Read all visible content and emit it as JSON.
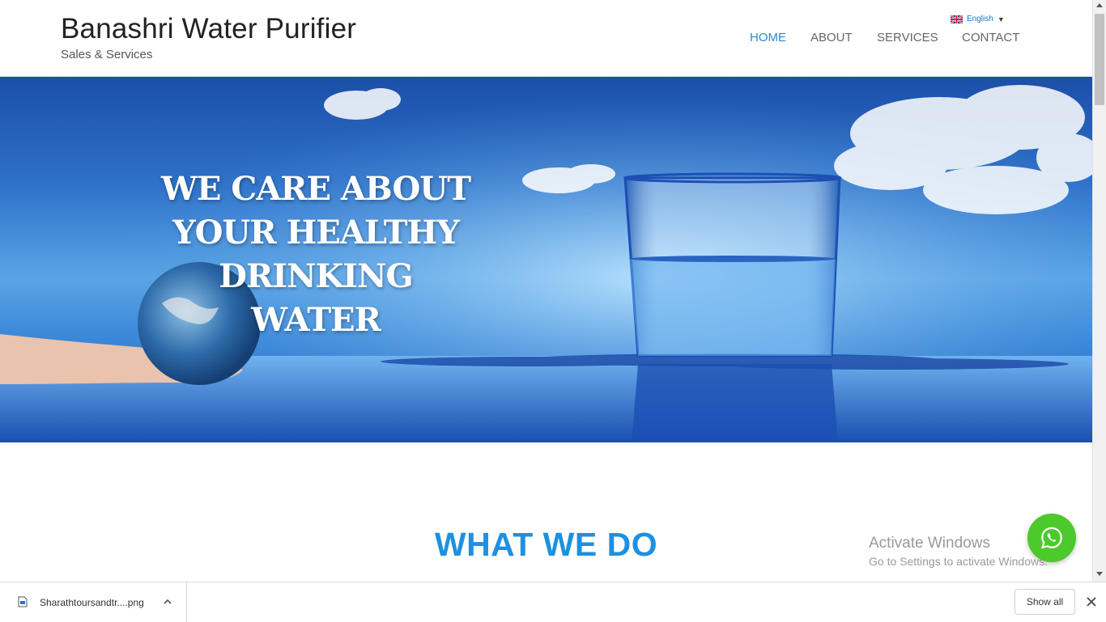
{
  "header": {
    "brand_title": "Banashri Water Purifier",
    "brand_tagline": "Sales & Services",
    "language": "English",
    "nav": [
      {
        "label": "HOME",
        "active": true
      },
      {
        "label": "ABOUT",
        "active": false
      },
      {
        "label": "SERVICES",
        "active": false
      },
      {
        "label": "CONTACT",
        "active": false
      }
    ]
  },
  "hero": {
    "lines": [
      "WE CARE ABOUT",
      "YOUR HEALTHY DRINKING",
      "WATER"
    ]
  },
  "section": {
    "title": "WHAT WE DO"
  },
  "watermark": {
    "title": "Activate Windows",
    "subtitle": "Go to Settings to activate Windows."
  },
  "download_bar": {
    "file_name": "Sharathtoursandtr....png",
    "show_all_label": "Show all"
  },
  "colors": {
    "accent": "#1e90e0",
    "whatsapp": "#4cc92b"
  },
  "icons": {
    "whatsapp": "whatsapp-icon",
    "flag": "uk-flag-icon",
    "close": "close-icon",
    "chevron": "chevron-up-icon",
    "file": "file-icon"
  }
}
